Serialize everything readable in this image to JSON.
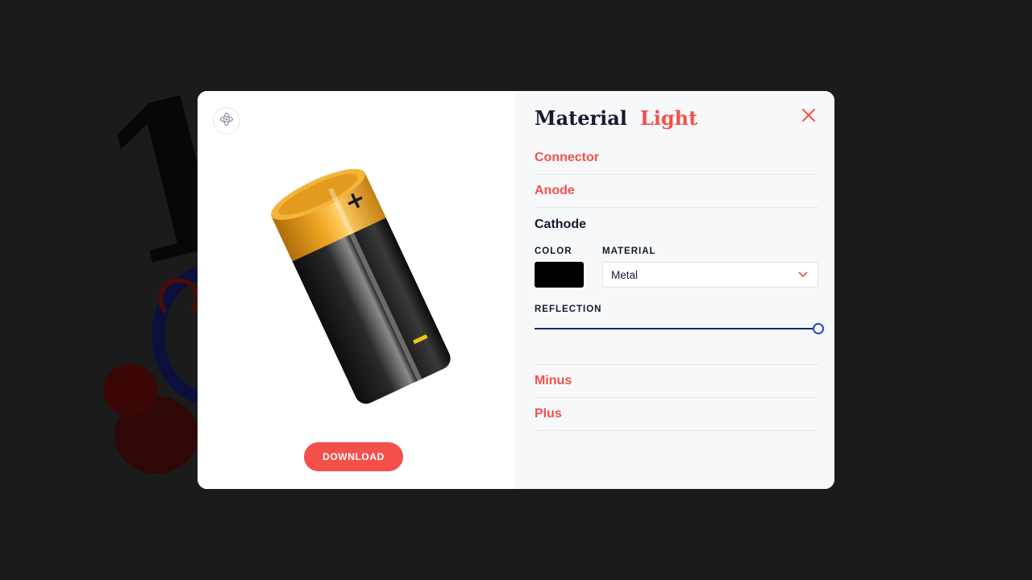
{
  "panel": {
    "tabs": [
      {
        "label": "Material",
        "active": true
      },
      {
        "label": "Light",
        "active": false
      }
    ],
    "sections": [
      {
        "label": "Connector"
      },
      {
        "label": "Anode"
      },
      {
        "label": "Cathode"
      },
      {
        "label": "Minus"
      },
      {
        "label": "Plus"
      }
    ],
    "cathode": {
      "color_label": "COLOR",
      "color_value": "#000000",
      "material_label": "MATERIAL",
      "material_value": "Metal",
      "reflection_label": "REFLECTION",
      "reflection_fraction": 1.0
    }
  },
  "preview": {
    "download_label": "DOWNLOAD",
    "rotate_icon": "rotate-3d-icon",
    "battery_plus": "+",
    "battery_minus": "–"
  },
  "colors": {
    "accent": "#f4504a",
    "heading": "#161a2e",
    "slider": "#1f46c9",
    "backdrop": "#1b1b1b"
  }
}
